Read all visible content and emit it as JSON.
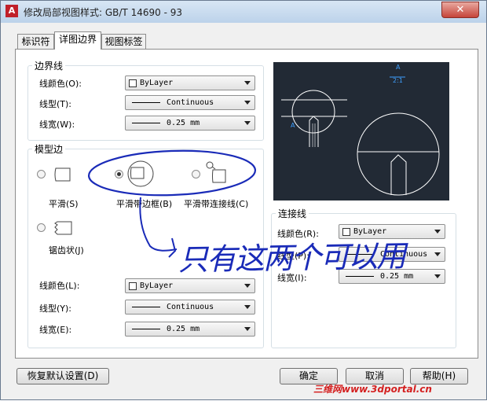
{
  "window": {
    "title": "修改局部视图样式: GB/T 14690 - 93",
    "close_label": "✕"
  },
  "tabs": [
    {
      "label": "标识符"
    },
    {
      "label": "详图边界"
    },
    {
      "label": "视图标签"
    }
  ],
  "boundary": {
    "title": "边界线",
    "color_label": "线颜色(O):",
    "color_value": "ByLayer",
    "linetype_label": "线型(T):",
    "linetype_value": "Continuous",
    "lineweight_label": "线宽(W):",
    "lineweight_value": "0.25 mm"
  },
  "model_edge": {
    "title": "模型边",
    "options": [
      {
        "label": "平滑(S)",
        "selected": false
      },
      {
        "label": "平滑带边框(B)",
        "selected": true
      },
      {
        "label": "平滑带连接线(C)",
        "selected": false
      },
      {
        "label": "锯齿状(J)",
        "selected": false
      }
    ],
    "color_label": "线颜色(L):",
    "color_value": "ByLayer",
    "linetype_label": "线型(Y):",
    "linetype_value": "Continuous",
    "lineweight_label": "线宽(E):",
    "lineweight_value": "0.25 mm"
  },
  "connection": {
    "title": "连接线",
    "color_label": "线颜色(R):",
    "color_value": "ByLayer",
    "linetype_label": "线型(P):",
    "linetype_value": "Continuous",
    "lineweight_label": "线宽(I):",
    "lineweight_value": "0.25 mm"
  },
  "preview": {
    "label_a": "A",
    "label_scale": "2:1",
    "label_a_left": "A"
  },
  "buttons": {
    "reset": "恢复默认设置(D)",
    "ok": "确定",
    "cancel": "取消",
    "help": "帮助(H)"
  },
  "annotation": {
    "handwritten_text": "只有这两个可以用"
  },
  "watermark": "三维网www.3dportal.cn",
  "colors": {
    "preview_bg": "#222a35",
    "preview_line": "#ffffff",
    "preview_text": "#3fa0ff",
    "annotation_ink": "#1a2bb8",
    "watermark": "#d42020"
  }
}
